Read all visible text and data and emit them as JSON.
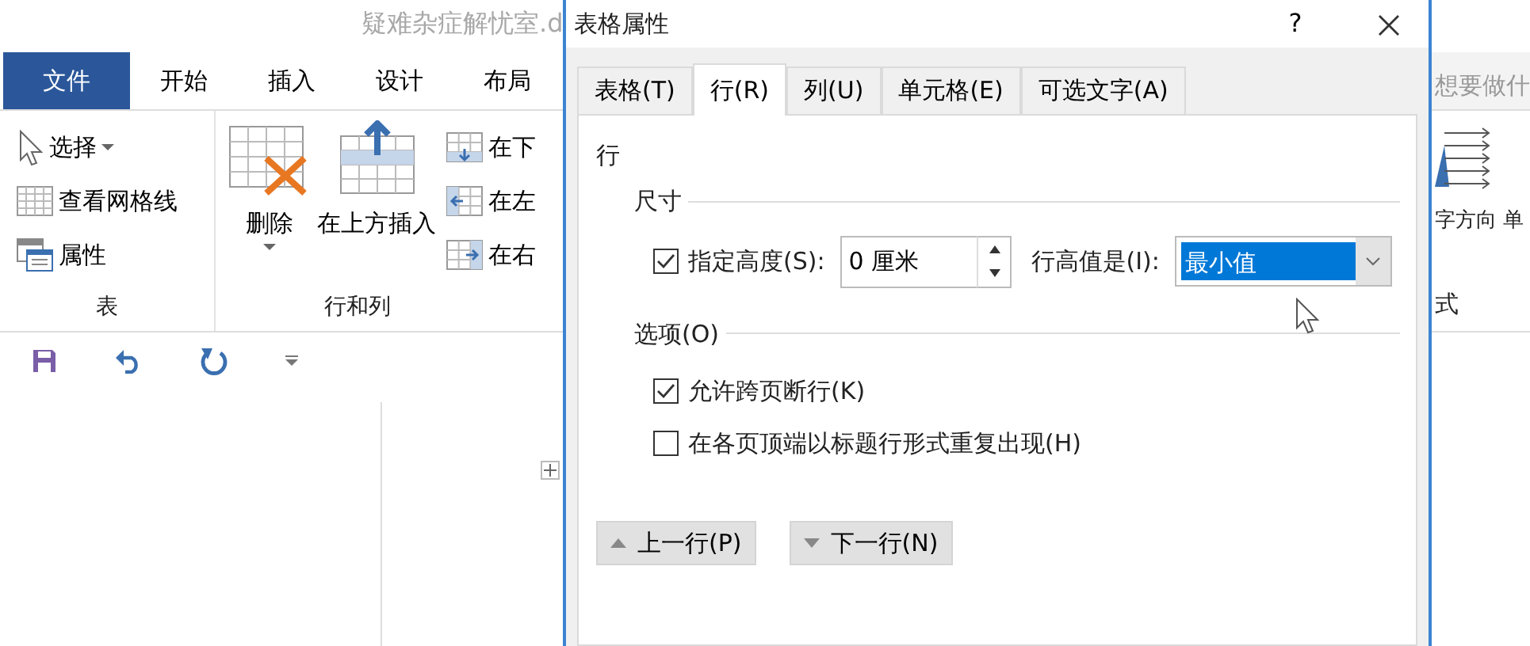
{
  "word": {
    "title": "疑难杂症解忧室.d",
    "tabs": [
      {
        "label": "文件",
        "selected": true
      },
      {
        "label": "开始",
        "selected": false
      },
      {
        "label": "插入",
        "selected": false
      },
      {
        "label": "设计",
        "selected": false
      },
      {
        "label": "布局",
        "selected": false
      }
    ],
    "tell_me": "想要做什",
    "ribbon_groups": [
      {
        "label": "表",
        "items": [
          {
            "label": "选择",
            "dropdown": true
          },
          {
            "label": "查看网格线",
            "dropdown": false
          },
          {
            "label": "属性",
            "dropdown": false
          }
        ]
      },
      {
        "label": "行和列",
        "big_items": [
          {
            "label": "删除",
            "dropdown": true
          },
          {
            "label": "在上方插入",
            "dropdown": false
          }
        ],
        "items": [
          {
            "label": "在下",
            "dropdown": false
          },
          {
            "label": "在左",
            "dropdown": false
          },
          {
            "label": "在右",
            "dropdown": false
          }
        ]
      }
    ],
    "ribbon_right": {
      "items": [
        "字方向",
        "单"
      ],
      "group_label": "式"
    }
  },
  "dialog": {
    "title": "表格属性",
    "help": "?",
    "tabs": [
      {
        "label": "表格(T)",
        "selected": false
      },
      {
        "label": "行(R)",
        "selected": true
      },
      {
        "label": "列(U)",
        "selected": false
      },
      {
        "label": "单元格(E)",
        "selected": false
      },
      {
        "label": "可选文字(A)",
        "selected": false
      }
    ],
    "section_title": "行",
    "size_group": {
      "label": "尺寸",
      "specify_height": {
        "label": "指定高度(S):",
        "checked": true
      },
      "height": {
        "value": "0 厘米"
      },
      "height_rule": {
        "label": "行高值是(I):",
        "value": "最小值",
        "selected": true
      }
    },
    "options_group": {
      "label": "选项(O)",
      "options": [
        {
          "label": "允许跨页断行(K)",
          "checked": true
        },
        {
          "label": "在各页顶端以标题行形式重复出现(H)",
          "checked": false
        }
      ]
    },
    "buttons": [
      {
        "label": "上一行(P)",
        "kind": "prev"
      },
      {
        "label": "下一行(N)",
        "kind": "next"
      }
    ]
  }
}
